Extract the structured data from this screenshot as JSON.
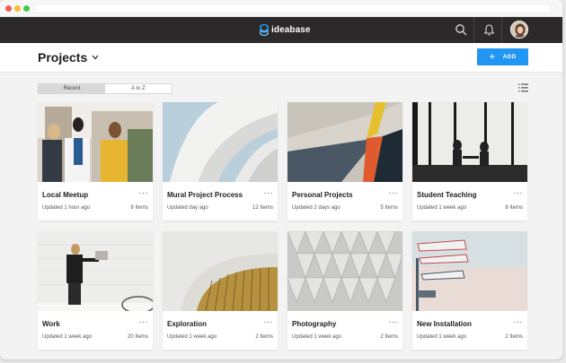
{
  "app": {
    "brand": "ideabase"
  },
  "header": {
    "title": "Projects",
    "add_label": "ADD"
  },
  "tabs": [
    {
      "label": "Recent",
      "active": true
    },
    {
      "label": "A to Z",
      "active": false
    }
  ],
  "colors": {
    "topbar": "#2b2929",
    "accent": "#2196f3"
  },
  "projects": [
    {
      "name": "Local Meetup",
      "updated": "Updated 1 hour ago",
      "count": "8 Items"
    },
    {
      "name": "Mural Project Process",
      "updated": "Updated day ago",
      "count": "12 Items"
    },
    {
      "name": "Personal Projects",
      "updated": "Updated 2 days ago",
      "count": "5 Items"
    },
    {
      "name": "Student Teaching",
      "updated": "Updated 1 week ago",
      "count": "8 Items"
    },
    {
      "name": "Work",
      "updated": "Updated 1 week ago",
      "count": "20 Items"
    },
    {
      "name": "Exploration",
      "updated": "Updated 1 week ago",
      "count": "2 Items"
    },
    {
      "name": "Photography",
      "updated": "Updated 1 week ago",
      "count": "2 Items"
    },
    {
      "name": "New Installation",
      "updated": "Updated 1 week ago",
      "count": "2 Items"
    }
  ],
  "more_label": "···"
}
